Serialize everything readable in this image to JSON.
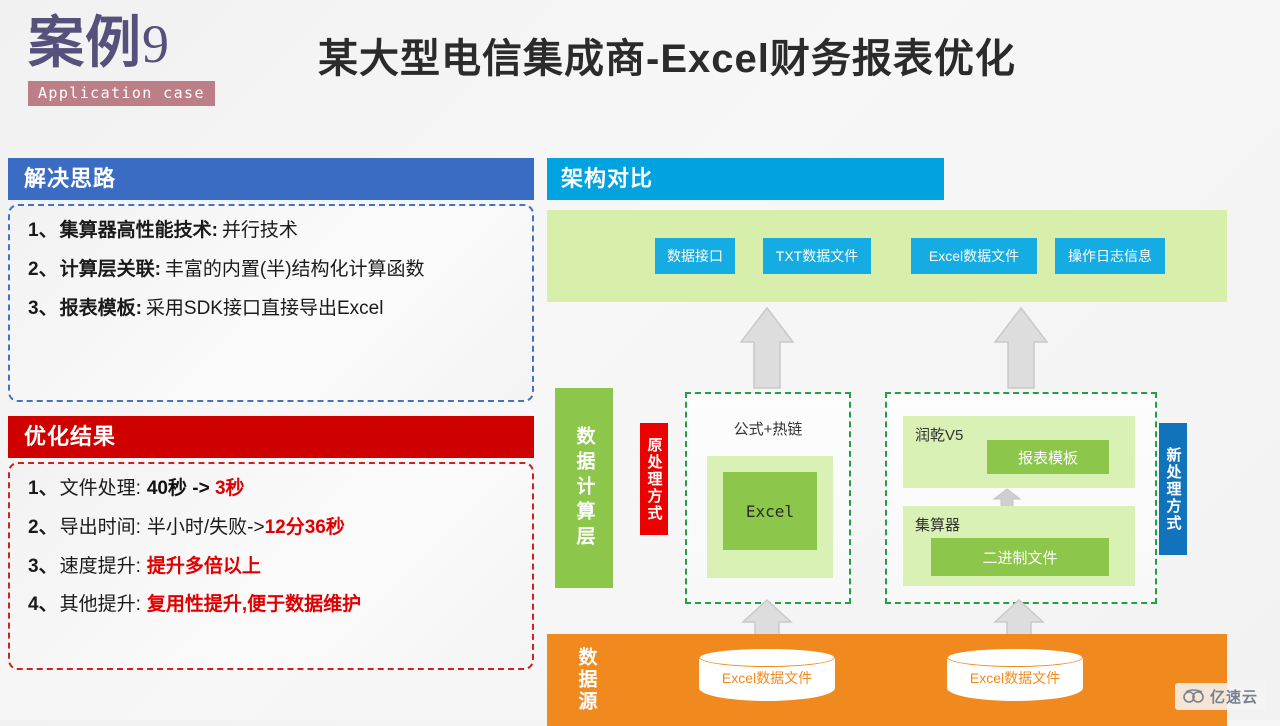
{
  "header": {
    "case_number": "案例",
    "case_index": "9",
    "subtitle": "Application case",
    "title": "某大型电信集成商-Excel财务报表优化"
  },
  "solution": {
    "header": "解决思路",
    "items": [
      {
        "index": "1、",
        "label": "集算器高性能技术:",
        "value": "并行技术"
      },
      {
        "index": "2、",
        "label": "计算层关联:",
        "value": "丰富的内置(半)结构化计算函数"
      },
      {
        "index": "3、",
        "label": "报表模板:",
        "value": "采用SDK接口直接导出Excel"
      }
    ]
  },
  "result": {
    "header": "优化结果",
    "items": [
      {
        "index": "1、",
        "label": "文件处理:",
        "before": "40秒",
        "arrow": " -> ",
        "after": "3秒"
      },
      {
        "index": "2、",
        "label": "导出时间:",
        "before": "半小时/失败->",
        "arrow": "",
        "after": "12分36秒"
      },
      {
        "index": "3、",
        "label": "速度提升:",
        "before": "",
        "arrow": "",
        "after": "提升多倍以上"
      },
      {
        "index": "4、",
        "label": "其他提升:",
        "before": "",
        "arrow": "",
        "after": "复用性提升,便于数据维护"
      }
    ]
  },
  "architecture": {
    "header": "架构对比",
    "application_layer": {
      "boxes": [
        {
          "label": "数据接口"
        },
        {
          "label": "TXT数据文件"
        },
        {
          "label": "Excel数据文件"
        },
        {
          "label": "操作日志信息"
        }
      ]
    },
    "calc_layer_label": "数据计算层",
    "old_way_tag": "原处理方式",
    "new_way_tag": "新处理方式",
    "old_panel": {
      "caption": "公式+热链",
      "inner_label": "Excel"
    },
    "new_panel": {
      "runqian_label": "润乾V5",
      "report_template": "报表模板",
      "jisuanqi_label": "集算器",
      "binary_file": "二进制文件"
    },
    "source_layer": {
      "label": "数据源",
      "cylinders": [
        {
          "label": "Excel数据文件"
        },
        {
          "label": "Excel数据文件"
        }
      ]
    }
  },
  "watermark": {
    "text": "亿速云"
  },
  "colors": {
    "solution_header": "#3b6cc3",
    "result_header": "#ce0000",
    "arch_header": "#00a3e0",
    "app_layer": "#d7efab",
    "source_layer": "#f08a1e",
    "green_bar": "#8cc64a",
    "blue_box": "#14ace3",
    "old_way": "#ec0000",
    "new_way": "#1273bd",
    "accent_red": "#e00000",
    "case_purple": "#56517b",
    "subtitle_rose": "#bd7f87"
  }
}
